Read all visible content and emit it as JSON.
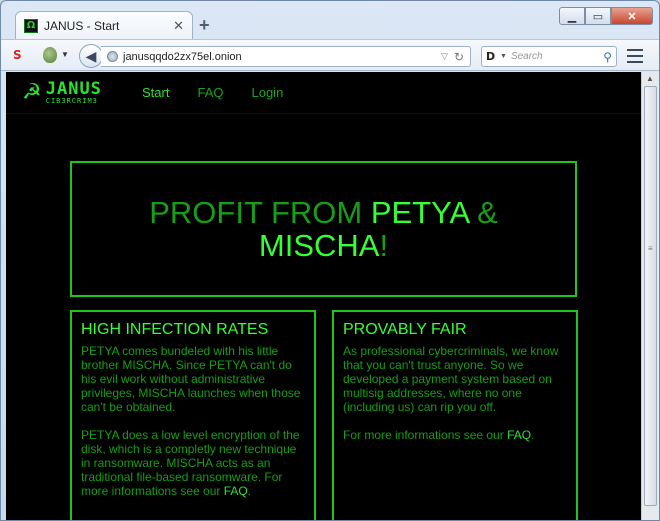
{
  "browser": {
    "tab_title": "JANUS - Start",
    "tab_favicon": "Ω",
    "url": "janusqqdo2zx75el.onion",
    "search_placeholder": "Search",
    "new_tab_symbol": "+",
    "close_tab_symbol": "✕",
    "toolbar_icon": "S"
  },
  "site": {
    "logo_main": "JANUS",
    "logo_sub": "CIB3RCRIM3",
    "logo_symbol": "☭",
    "nav": [
      "Start",
      "FAQ",
      "Login"
    ],
    "hero": {
      "part1": "PROFIT FROM ",
      "petya": "PETYA",
      "amp": " & ",
      "mischa": "MISCHA",
      "excl": "!"
    },
    "cards": {
      "left": {
        "title": "HIGH INFECTION RATES",
        "p1": "PETYA comes bundeled with his little brother MISCHA. Since PETYA can't do his evil work without administrative privileges, MISCHA launches when those can't be obtained.",
        "p2_text": "PETYA does a low level encryption of the disk, which is a completly new technique in ransomware. MISCHA acts as an traditional file-based ransomware. For more informations see our ",
        "p2_link": "FAQ",
        "p2_end": "."
      },
      "right": {
        "title": "PROVABLY FAIR",
        "p1": "As professional cybercriminals, we know that you can't trust anyone. So we developed a payment system based on multisig addresses, where no one (including us) can rip you off.",
        "p2_text": "For more informations see our ",
        "p2_link": "FAQ",
        "p2_end": "."
      }
    }
  },
  "colors": {
    "bright_green": "#35ff35",
    "dim_green": "#169e16",
    "background": "#000000"
  }
}
